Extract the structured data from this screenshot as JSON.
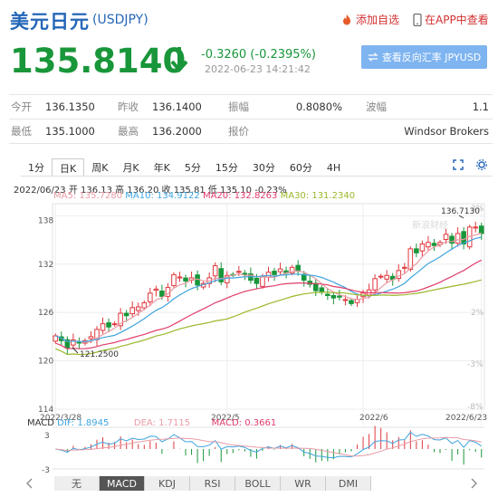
{
  "header": {
    "title_cn": "美元日元",
    "code": "(USDJPY)",
    "add_fav": "添加自选",
    "in_app": "在APP中查看"
  },
  "quote": {
    "price": "135.8140",
    "change": "-0.3260 (-0.2395%)",
    "time": "2022-06-23 14:21:42",
    "reverse_btn": "查看反向汇率 JPYUSD",
    "direction": "down",
    "color_down": "#19963a"
  },
  "stats": {
    "open_label": "今开",
    "open": "136.1350",
    "prev_label": "昨收",
    "prev": "136.1400",
    "amp_label": "振幅",
    "amp": "0.8080%",
    "wave_label": "波幅",
    "wave": "1.1",
    "low_label": "最低",
    "low": "135.1000",
    "high_label": "最高",
    "high": "136.2000",
    "quoter_label": "报价",
    "quoter": "Windsor Brokers"
  },
  "tabs": [
    "1分",
    "日K",
    "周K",
    "月K",
    "年K",
    "5分",
    "15分",
    "30分",
    "60分",
    "4H"
  ],
  "active_tab": 1,
  "legend": {
    "line1": "2022/06/23 开 136.13 高 136.20 收 135.81 低 135.10 -0.23%",
    "ma5": "MA5: 135.7280",
    "ma10": "MA10: 134.9122",
    "ma20": "MA20: 132.8263",
    "ma30": "MA30: 131.2340",
    "ma5_color": "#e99ba5",
    "ma10_color": "#3ea4de",
    "ma20_color": "#e03c6a",
    "ma30_color": "#9ab82a"
  },
  "chart_data": {
    "type": "candlestick",
    "yticks": [
      "138",
      "132",
      "126",
      "120",
      "114"
    ],
    "pct_ticks": [
      "3%",
      "2%",
      "-3%",
      "-8%"
    ],
    "xticks": [
      "2022/3/28",
      "2022/5",
      "2022/6",
      "2022/6/23"
    ],
    "high_annotation": "136.7130",
    "low_annotation": "121.2500",
    "watermark": "新浪财经",
    "ylim": [
      114,
      139.5
    ],
    "closes": [
      123.1,
      122.5,
      121.6,
      122.6,
      122.2,
      122.5,
      123.0,
      123.9,
      124.6,
      124.2,
      124.6,
      125.9,
      125.6,
      126.6,
      126.7,
      127.2,
      128.4,
      128.9,
      128.0,
      129.1,
      130.7,
      130.4,
      129.9,
      130.3,
      129.4,
      129.6,
      130.3,
      131.8,
      129.8,
      130.6,
      130.7,
      131.1,
      130.8,
      130.0,
      129.6,
      130.5,
      131.0,
      130.7,
      131.4,
      130.9,
      131.6,
      131.1,
      130.0,
      129.5,
      128.7,
      128.5,
      128.1,
      127.8,
      127.9,
      127.6,
      127.1,
      127.6,
      128.4,
      128.8,
      130.2,
      130.5,
      130.6,
      130.1,
      131.2,
      131.6,
      133.9,
      133.4,
      134.5,
      134.7,
      134.3,
      134.7,
      135.7,
      134.6,
      135.8,
      134.5,
      136.6,
      136.6,
      135.8
    ],
    "macd": {
      "dif": "DIF: 1.8945",
      "dea": "DEA: 1.7115",
      "macd": "MACD: 0.3661",
      "yticks": [
        "3",
        "-3"
      ]
    }
  },
  "indicators": [
    "无",
    "MACD",
    "KDJ",
    "RSI",
    "BOLL",
    "WR",
    "DMI"
  ],
  "active_indicator": 1
}
